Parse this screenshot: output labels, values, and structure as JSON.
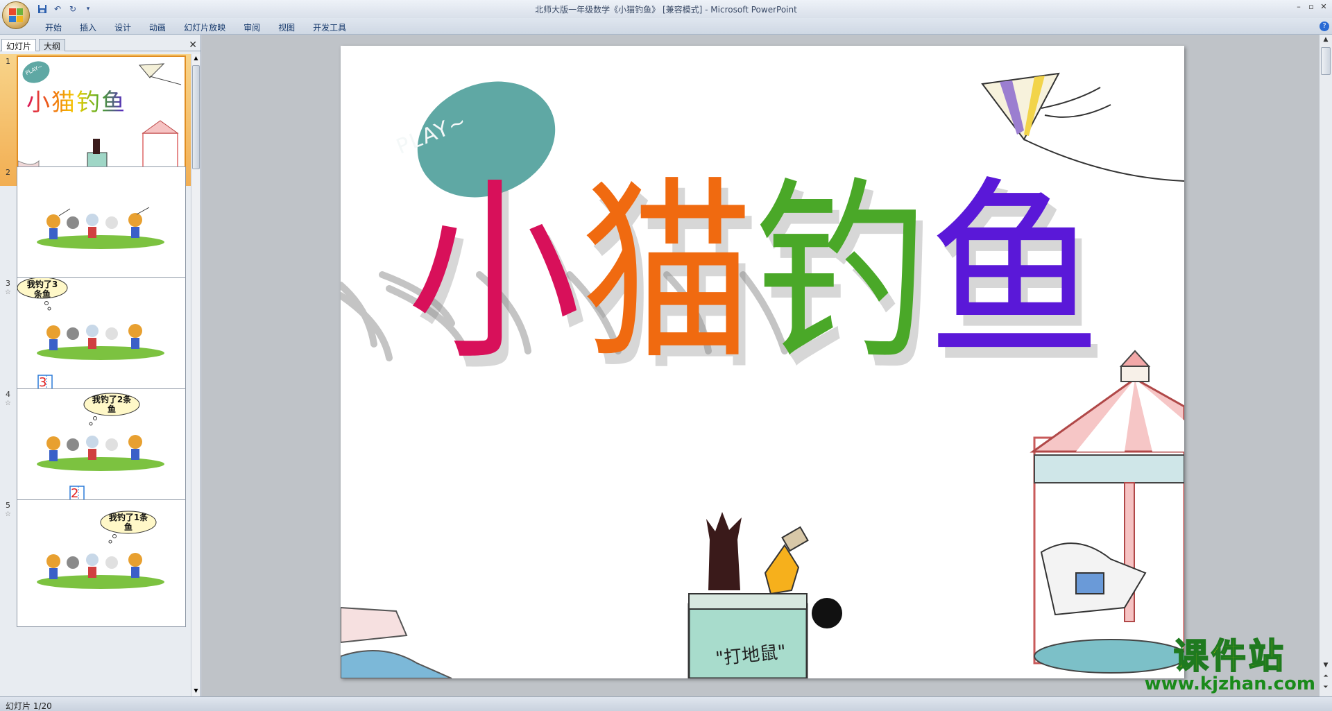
{
  "window": {
    "title": "北师大版一年级数学《小猫钓鱼》 [兼容模式] - Microsoft PowerPoint",
    "controls": [
      "–",
      "▫",
      "✕"
    ]
  },
  "ribbon": {
    "tabs": [
      "开始",
      "插入",
      "设计",
      "动画",
      "幻灯片放映",
      "审阅",
      "视图",
      "开发工具"
    ]
  },
  "pane": {
    "tab_slides": "幻灯片",
    "tab_outline": "大纲",
    "close": "✕",
    "thumbnails": [
      {
        "number": "1",
        "selected": true,
        "title": "小猫钓鱼",
        "play": "PLAY~"
      },
      {
        "number": "2"
      },
      {
        "number": "3",
        "bubble": "我钓了3条鱼",
        "answer": "3"
      },
      {
        "number": "4",
        "bubble": "我钓了2条鱼",
        "answer": "2"
      },
      {
        "number": "5",
        "bubble": "我钓了1条鱼"
      }
    ]
  },
  "slide": {
    "play_text": "PLAY~",
    "title_chars": [
      "小",
      "猫",
      "钓",
      "鱼"
    ],
    "title_colors": [
      "#d8105a",
      "#f06a10",
      "#4aa828",
      "#5a18d8"
    ],
    "game_sign": "\"打地鼠\""
  },
  "status": {
    "slide_indicator": "幻灯片 1/20"
  },
  "watermark": {
    "title": "课件站",
    "url": "www.kjzhan.com"
  },
  "colors": {
    "selection": "#f2ae52",
    "play_blob": "#5fa8a4"
  }
}
